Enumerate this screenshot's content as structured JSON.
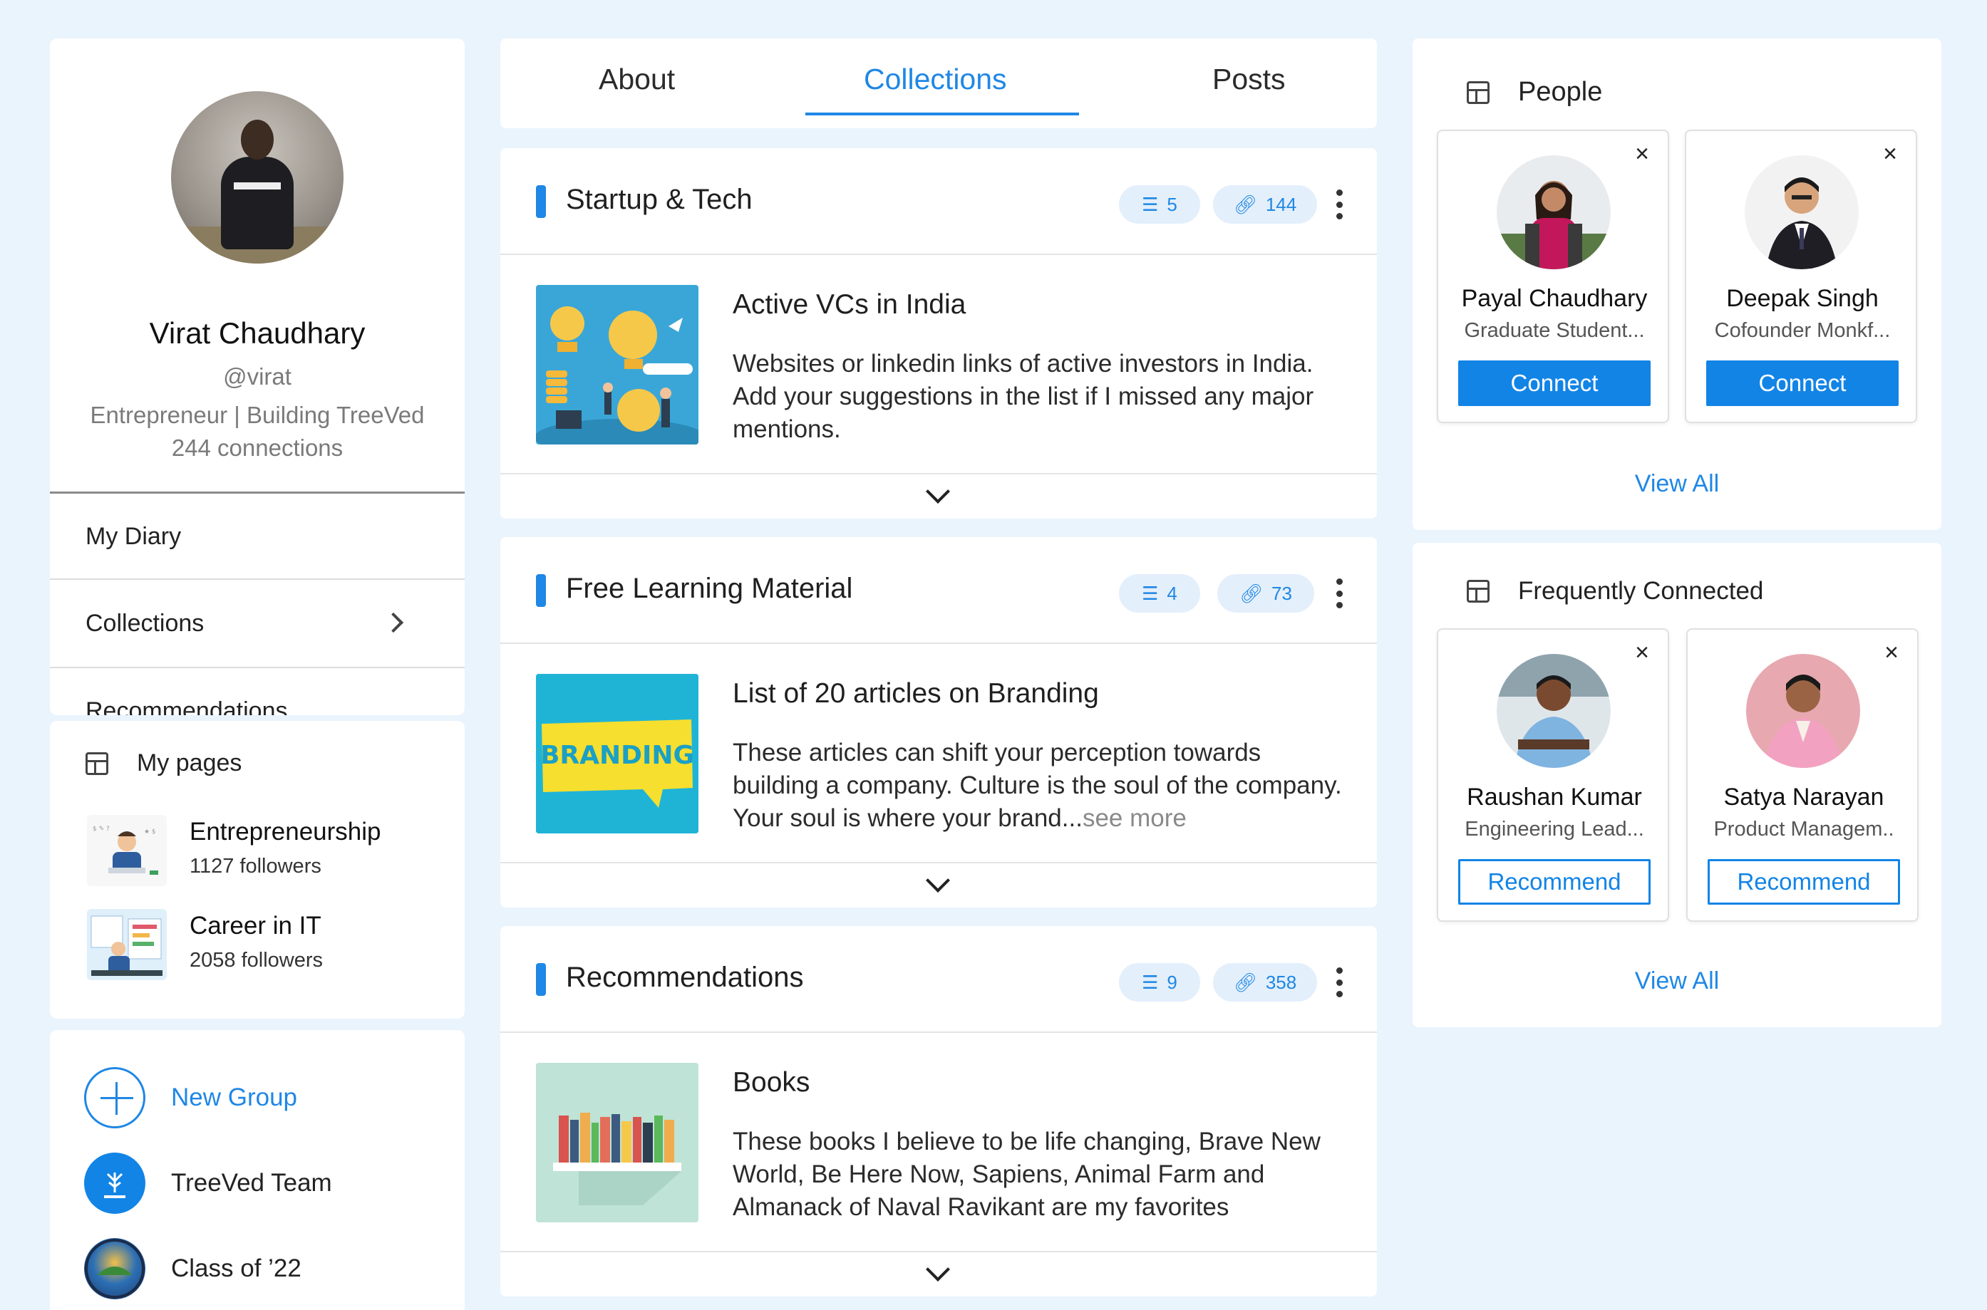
{
  "profile": {
    "name": "Virat Chaudhary",
    "handle": "@virat",
    "tagline": "Entrepreneur | Building TreeVed",
    "connections": "244 connections"
  },
  "menu": {
    "items": [
      {
        "label": "My Diary"
      },
      {
        "label": "Collections"
      },
      {
        "label": "Recommendations"
      }
    ]
  },
  "my_pages": {
    "title": "My pages",
    "items": [
      {
        "title": "Entrepreneurship",
        "followers": "1127 followers"
      },
      {
        "title": "Career in IT",
        "followers": "2058 followers"
      }
    ]
  },
  "groups": {
    "new_group": "New Group",
    "items": [
      {
        "label": "TreeVed Team"
      },
      {
        "label": "Class of ’22"
      }
    ]
  },
  "tabs": [
    {
      "label": "About"
    },
    {
      "label": "Collections",
      "active": true
    },
    {
      "label": "Posts"
    }
  ],
  "collections": [
    {
      "title": "Startup & Tech",
      "list_count": "5",
      "link_count": "144",
      "item": {
        "title": "Active VCs in India",
        "description": "Websites or linkedin links of active investors in India. Add your suggestions in the list if I missed any major mentions."
      }
    },
    {
      "title": "Free Learning Material",
      "list_count": "4",
      "link_count": "73",
      "item": {
        "title": "List of 20 articles on Branding",
        "description": "These articles can shift your perception towards building a company. Culture is the soul of the company. Your soul is where your brand...",
        "see_more": "see more",
        "thumb_text": "BRANDING"
      }
    },
    {
      "title": "Recommendations",
      "list_count": "9",
      "link_count": "358",
      "item": {
        "title": "Books",
        "description": "These books I believe to be life changing, Brave New World, Be Here Now, Sapiens, Animal Farm and Almanack of Naval Ravikant are my favorites"
      }
    }
  ],
  "people": {
    "title": "People",
    "cards": [
      {
        "name": "Payal Chaudhary",
        "subtitle": "Graduate Student...",
        "action": "Connect"
      },
      {
        "name": "Deepak Singh",
        "subtitle": "Cofounder Monkf...",
        "action": "Connect"
      }
    ],
    "view_all": "View All"
  },
  "frequently_connected": {
    "title": "Frequently Connected",
    "cards": [
      {
        "name": "Raushan Kumar",
        "subtitle": "Engineering Lead...",
        "action": "Recommend"
      },
      {
        "name": "Satya Narayan",
        "subtitle": "Product Managem..",
        "action": "Recommend"
      }
    ],
    "view_all": "View All"
  },
  "colors": {
    "accent": "#1f87e5",
    "background": "#eaf4fd",
    "pill_bg": "#e3effb"
  },
  "icons": {
    "close": "close-icon",
    "more": "more-vertical-icon",
    "list": "list-icon",
    "link": "link-icon",
    "panel": "panel-layout-icon",
    "chevron_right": "chevron-right-icon",
    "chevron_down": "chevron-down-icon",
    "plus": "plus-circle-icon"
  }
}
